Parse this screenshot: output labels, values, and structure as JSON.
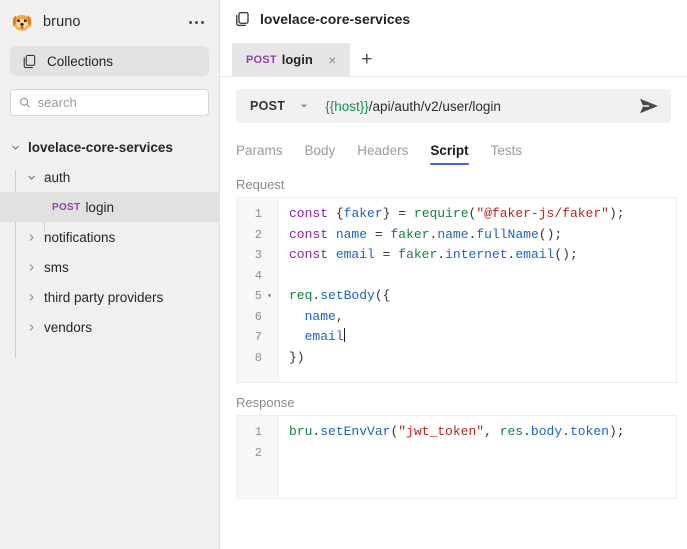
{
  "app": {
    "brand_name": "bruno",
    "logo_icon": "bruno-dog-logo",
    "menu_icon": "ellipsis-icon"
  },
  "sidebar": {
    "collections_button": {
      "label": "Collections",
      "icon": "folders-icon"
    },
    "search": {
      "placeholder": "search",
      "value": "",
      "icon": "search-icon"
    },
    "tree": [
      {
        "label": "lovelace-core-services",
        "level": 0,
        "expanded": true,
        "selected": false,
        "method": ""
      },
      {
        "label": "auth",
        "level": 1,
        "expanded": true,
        "selected": false,
        "method": ""
      },
      {
        "label": "login",
        "level": 2,
        "expanded": false,
        "selected": true,
        "method": "POST"
      },
      {
        "label": "notifications",
        "level": 1,
        "expanded": false,
        "selected": false,
        "method": ""
      },
      {
        "label": "sms",
        "level": 1,
        "expanded": false,
        "selected": false,
        "method": ""
      },
      {
        "label": "third party providers",
        "level": 1,
        "expanded": false,
        "selected": false,
        "method": ""
      },
      {
        "label": "vendors",
        "level": 1,
        "expanded": false,
        "selected": false,
        "method": ""
      }
    ]
  },
  "main": {
    "collection_title": "lovelace-core-services",
    "collection_icon": "folders-icon",
    "tabs": [
      {
        "method": "POST",
        "name": "login",
        "active": true,
        "close_label": "×"
      }
    ],
    "add_tab_label": "+",
    "request_bar": {
      "method": "POST",
      "method_chevron": "chevron-down-icon",
      "url_variable": "{{host}}",
      "url_path": "/api/auth/v2/user/login",
      "send_icon": "send-arrow-icon"
    },
    "subtabs": [
      {
        "label": "Params",
        "active": false
      },
      {
        "label": "Body",
        "active": false
      },
      {
        "label": "Headers",
        "active": false
      },
      {
        "label": "Script",
        "active": true
      },
      {
        "label": "Tests",
        "active": false
      }
    ],
    "request_section": {
      "label": "Request",
      "line_numbers": [
        "1",
        "2",
        "3",
        "4",
        "5",
        "6",
        "7",
        "8"
      ],
      "fold_line": "5",
      "lines": [
        "const {faker} = require(\"@faker-js/faker\");",
        "const name = faker.name.fullName();",
        "const email = faker.internet.email();",
        "",
        "req.setBody({",
        "  name,",
        "  email",
        "})"
      ]
    },
    "response_section": {
      "label": "Response",
      "line_numbers": [
        "1",
        "2"
      ],
      "lines": [
        "bru.setEnvVar(\"jwt_token\", res.body.token);",
        ""
      ]
    }
  },
  "colors": {
    "accent_blue": "#4c63d2",
    "method_purple": "#8e44ad",
    "url_variable_green": "#168f52",
    "sidebar_bg": "#f0f0f0",
    "selected_row": "#e0e0e0",
    "keyword": "#8e24aa",
    "string": "#b3261e",
    "object": "#17803d",
    "function": "#2062c4"
  }
}
